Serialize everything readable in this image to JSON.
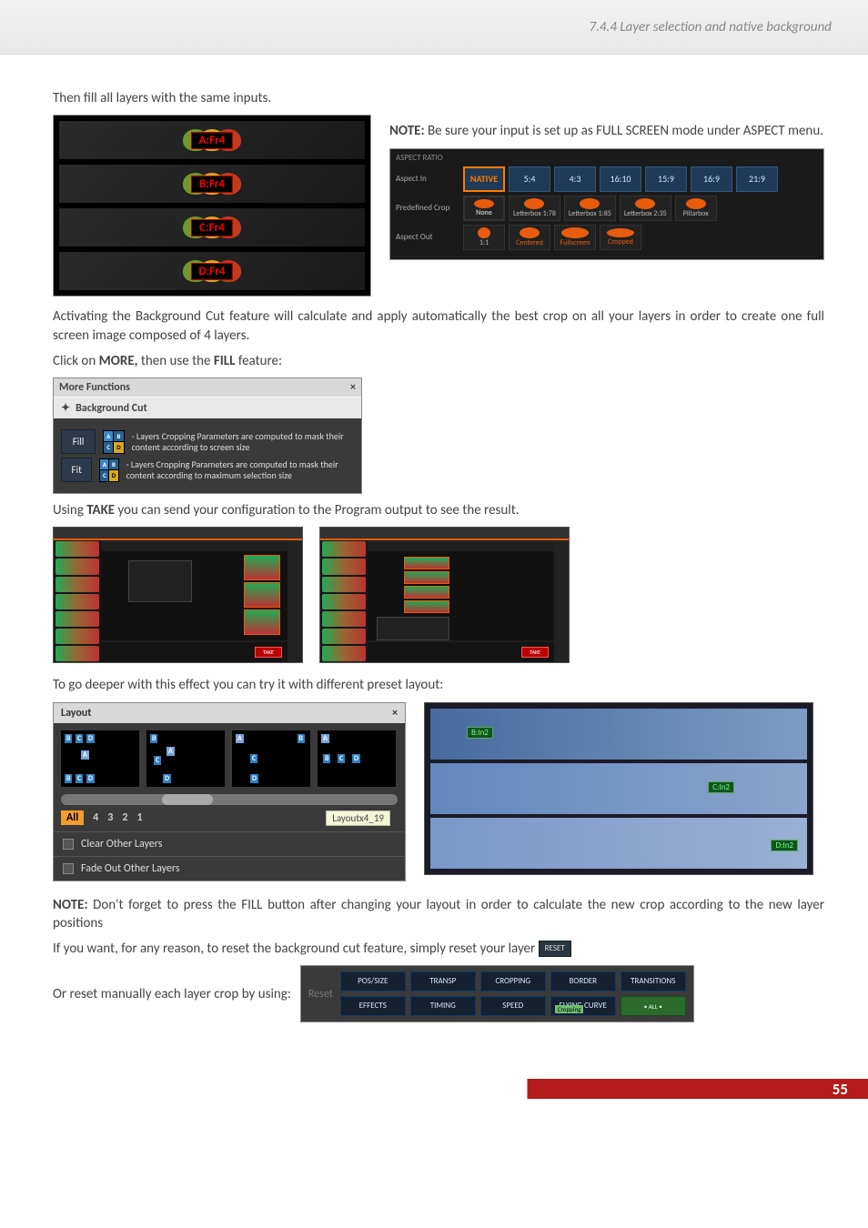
{
  "header": {
    "section": "7.4.4 Layer selection and native background"
  },
  "intro1": "Then fill all layers with the same inputs.",
  "layers": [
    "A:Fr4",
    "B:Fr4",
    "C:Fr4",
    "D:Fr4"
  ],
  "note1": {
    "label": "NOTE:",
    "text": "Be sure your input is set up as FULL SCREEN mode under ASPECT menu."
  },
  "aspect": {
    "header": "ASPECT RATIO",
    "rows": {
      "aspectIn": {
        "label": "Aspect In",
        "tiles": [
          "NATIVE",
          "5:4",
          "4:3",
          "16:10",
          "15:9",
          "16:9",
          "21:9"
        ]
      },
      "crop": {
        "label": "Predefined Crop",
        "tiles": [
          "None",
          "Letterbox 1:78",
          "Letterbox 1:85",
          "Letterbox 2:35",
          "Pillarbox"
        ]
      },
      "aspectOut": {
        "label": "Aspect Out",
        "tiles": [
          "1:1",
          "Centered",
          "Fullscreen",
          "Cropped"
        ]
      }
    }
  },
  "para_bgcut": "Activating the Background Cut feature will calculate and apply automatically the best crop on all your layers in order to create one full screen image composed of 4 layers.",
  "click_more": {
    "pre": "Click on ",
    "more": "MORE,",
    "mid": " then use the ",
    "fill": "FILL",
    "post": " feature:"
  },
  "moreFn": {
    "title": "More Functions",
    "close": "×",
    "tab": "Background Cut",
    "fill": {
      "btn": "Fill",
      "desc": "- Layers Cropping Parameters are computed to mask their content according to screen size"
    },
    "fit": {
      "btn": "Fit",
      "desc": "- Layers Cropping Parameters are computed to mask their content according to maximum selection size"
    }
  },
  "using_take": {
    "pre": "Using ",
    "take": "TAKE",
    "post": " you can send your configuration to the Program output to see the result."
  },
  "sw": {
    "take": "TAKE"
  },
  "deeper": "To go deeper with this effect you can try it with different preset layout:",
  "layoutDlg": {
    "title": "Layout",
    "close": "×",
    "tabs": {
      "all": "All",
      "t4": "4",
      "t3": "3",
      "t2": "2",
      "t1": "1"
    },
    "tooltip": "Layoutx4_19",
    "opts": {
      "clear": "Clear Other Layers",
      "fade": "Fade Out Other Layers"
    }
  },
  "preview_tags": {
    "b": "B:In2",
    "c": "C:In2",
    "d": "D:In2"
  },
  "note2": {
    "label": "NOTE:",
    "text": "Don't forget to press the FILL button after changing your layout in order to calculate the new crop according to the new layer positions"
  },
  "reset_line": {
    "pre": "If you want, for any reason, to reset the background cut feature, simply reset your layer",
    "btn": "RESET"
  },
  "reset_manual": "Or reset manually each layer crop by using:",
  "resetPanel": {
    "label": "Reset",
    "btns": {
      "possize": "POS/SIZE",
      "transp": "TRANSP",
      "cropping": "CROPPING",
      "border": "BORDER",
      "transitions": "TRANSITIONS",
      "effects": "EFFECTS",
      "timing": "TIMING",
      "speed": "SPEED",
      "flying": "FLYING CURVE",
      "flying_hl": "Cropping",
      "all": "• ALL •"
    }
  },
  "page_number": "55"
}
